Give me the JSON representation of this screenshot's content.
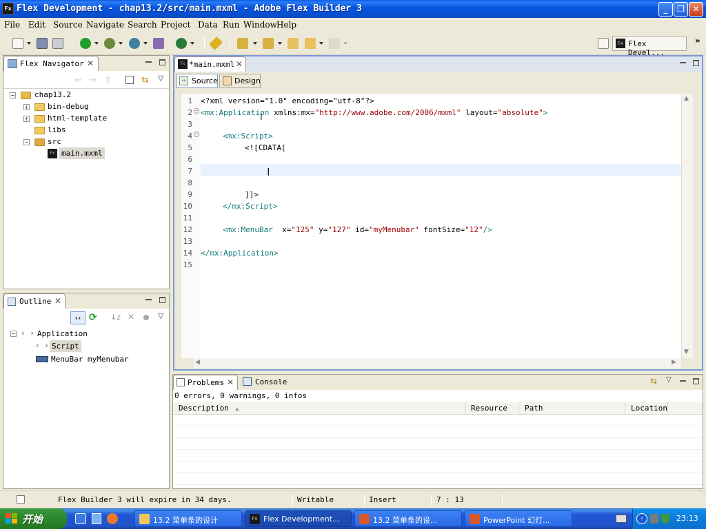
{
  "window": {
    "app_icon": "Fx",
    "title": "Flex Development - chap13.2/src/main.mxml - Adobe Flex Builder 3",
    "minimize_glyph": "_",
    "restore_glyph": "❐",
    "close_glyph": "✕"
  },
  "menu": [
    "File",
    "Edit",
    "Source",
    "Navigate",
    "Search",
    "Project",
    "Data",
    "Run",
    "Window",
    "Help"
  ],
  "perspective": {
    "label": "Flex Devel...",
    "fx": "Fx",
    "more": "»"
  },
  "navigator": {
    "tab_label": "Flex Navigator",
    "close_glyph": "✕",
    "tree": {
      "project": "chap13.2",
      "children": [
        "bin-debug",
        "html-template",
        "libs",
        "src"
      ],
      "src_file": "main.mxml"
    }
  },
  "editor": {
    "tab_label": "*main.mxml",
    "close_glyph": "✕",
    "source_tab": "Source",
    "design_tab": "Design",
    "line_numbers": [
      "1",
      "2",
      "3",
      "4",
      "5",
      "6",
      "7",
      "8",
      "9",
      "10",
      "11",
      "12",
      "13",
      "14",
      "15"
    ],
    "cursor": "|",
    "code": {
      "l1": "<?xml version=\"1.0\" encoding=\"utf-8\"?>",
      "l2_tag": "<mx:Application",
      "l2_attr1": " xmlns:mx=",
      "l2_val1": "\"http://www.adobe.com/2006/mxml\"",
      "l2_attr2": " layout=",
      "l2_val2": "\"absolute\"",
      "l2_end": ">",
      "l4": "<mx:Script>",
      "l5": "<![CDATA[",
      "l9": "]]>",
      "l10": "</mx:Script>",
      "l12_tag": "<mx:MenuBar",
      "l12_a1": "  x=",
      "l12_v1": "\"125\"",
      "l12_a2": " y=",
      "l12_v2": "\"127\"",
      "l12_a3": " id=",
      "l12_v3": "\"myMenubar\"",
      "l12_a4": " fontSize=",
      "l12_v4": "\"12\"",
      "l12_end": "/>",
      "l14": "</mx:Application>"
    }
  },
  "outline": {
    "tab_label": "Outline",
    "close_glyph": "✕",
    "items": [
      "Application",
      "Script",
      "MenuBar myMenubar"
    ]
  },
  "problems": {
    "tab_label": "Problems",
    "console_tab": "Console",
    "close_glyph": "✕",
    "summary": "0 errors, 0 warnings, 0 infos",
    "columns": [
      "Description",
      "Resource",
      "Path",
      "Location"
    ],
    "sort_glyph": "▲"
  },
  "status": {
    "message": "Flex Builder 3 will expire in 34 days.",
    "writable": "Writable",
    "insert_mode": "Insert",
    "position": "7 : 13"
  },
  "taskbar": {
    "start_label": "开始",
    "tasks": [
      "13.2 菜单条的设计",
      "Flex Development...",
      "13.2 菜单条的设...",
      "PowerPoint 幻灯..."
    ],
    "clock": "23:13"
  },
  "colors": {
    "title_blue": "#0a58e0",
    "editor_border": "#7a9bd4",
    "xml_tag": "#157a7a",
    "xml_string": "#2a00ff",
    "current_line": "#e8f2fe"
  }
}
